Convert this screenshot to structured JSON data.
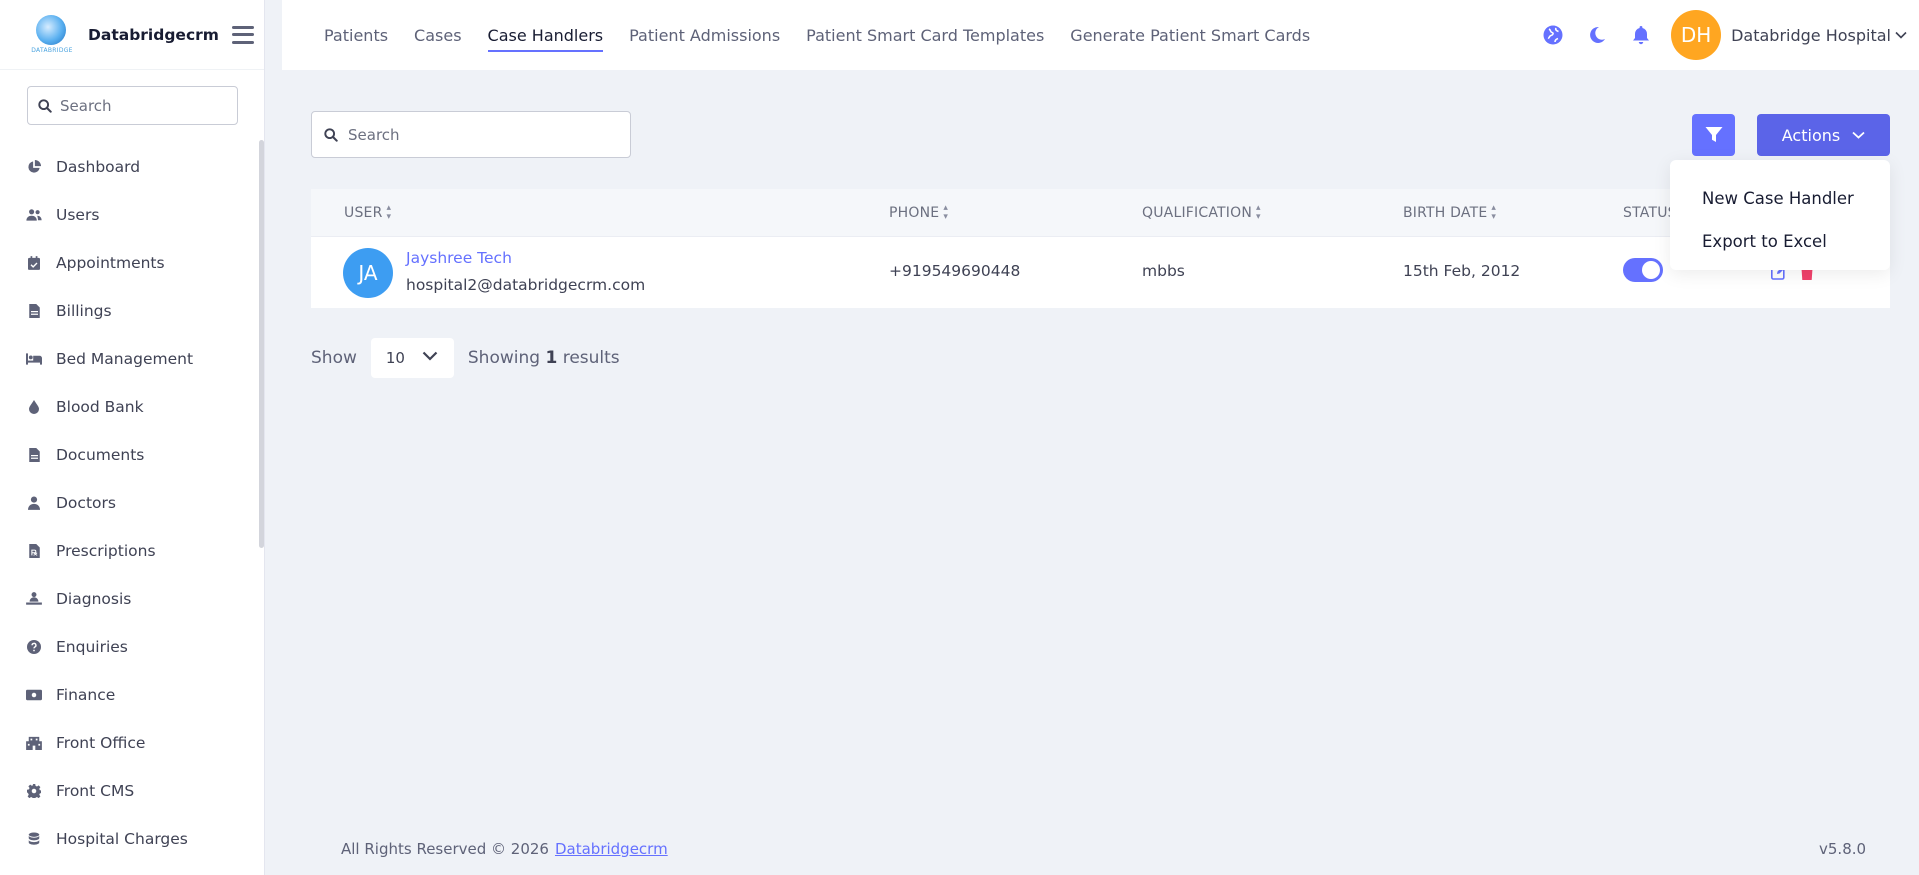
{
  "brand": {
    "name": "Databridgecrm",
    "logo_caption": "DATABRIDGE"
  },
  "sidebar": {
    "search_placeholder": "Search",
    "items": [
      {
        "label": "Dashboard",
        "icon": "chart-pie-icon"
      },
      {
        "label": "Users",
        "icon": "users-icon"
      },
      {
        "label": "Appointments",
        "icon": "calendar-check-icon"
      },
      {
        "label": "Billings",
        "icon": "file-invoice-icon"
      },
      {
        "label": "Bed Management",
        "icon": "bed-icon"
      },
      {
        "label": "Blood Bank",
        "icon": "droplet-icon"
      },
      {
        "label": "Documents",
        "icon": "file-icon"
      },
      {
        "label": "Doctors",
        "icon": "user-doctor-icon"
      },
      {
        "label": "Prescriptions",
        "icon": "file-prescription-icon"
      },
      {
        "label": "Diagnosis",
        "icon": "person-diagnosis-icon"
      },
      {
        "label": "Enquiries",
        "icon": "question-circle-icon"
      },
      {
        "label": "Finance",
        "icon": "money-bill-icon"
      },
      {
        "label": "Front Office",
        "icon": "building-icon"
      },
      {
        "label": "Front CMS",
        "icon": "gear-icon"
      },
      {
        "label": "Hospital Charges",
        "icon": "coins-icon"
      }
    ]
  },
  "header": {
    "tabs": [
      {
        "label": "Patients"
      },
      {
        "label": "Cases"
      },
      {
        "label": "Case Handlers",
        "active": true
      },
      {
        "label": "Patient Admissions"
      },
      {
        "label": "Patient Smart Card Templates"
      },
      {
        "label": "Generate Patient Smart Cards"
      }
    ],
    "user_initials": "DH",
    "user_name": "Databridge Hospital"
  },
  "main": {
    "search_placeholder": "Search",
    "actions_label": "Actions",
    "actions_menu": [
      "New Case Handler",
      "Export to Excel"
    ],
    "columns": [
      "USER",
      "PHONE",
      "QUALIFICATION",
      "BIRTH DATE",
      "STATUS"
    ],
    "rows": [
      {
        "initials": "JA",
        "name": "Jayshree Tech",
        "email": "hospital2@databridgecrm.com",
        "phone": "+919549690448",
        "qualification": "mbbs",
        "birth_date": "15th Feb, 2012",
        "status_active": true
      }
    ],
    "pager": {
      "show_label": "Show",
      "per_page": "10",
      "showing_prefix": "Showing",
      "count": "1",
      "showing_suffix": "results"
    }
  },
  "footer": {
    "rights": "All Rights Reserved © 2026",
    "link": "Databridgecrm",
    "version": "v5.8.0"
  },
  "colors": {
    "primary": "#6571ff",
    "accent_orange": "#ffa621",
    "avatar_blue": "#3d9df2",
    "danger": "#f1416c"
  }
}
